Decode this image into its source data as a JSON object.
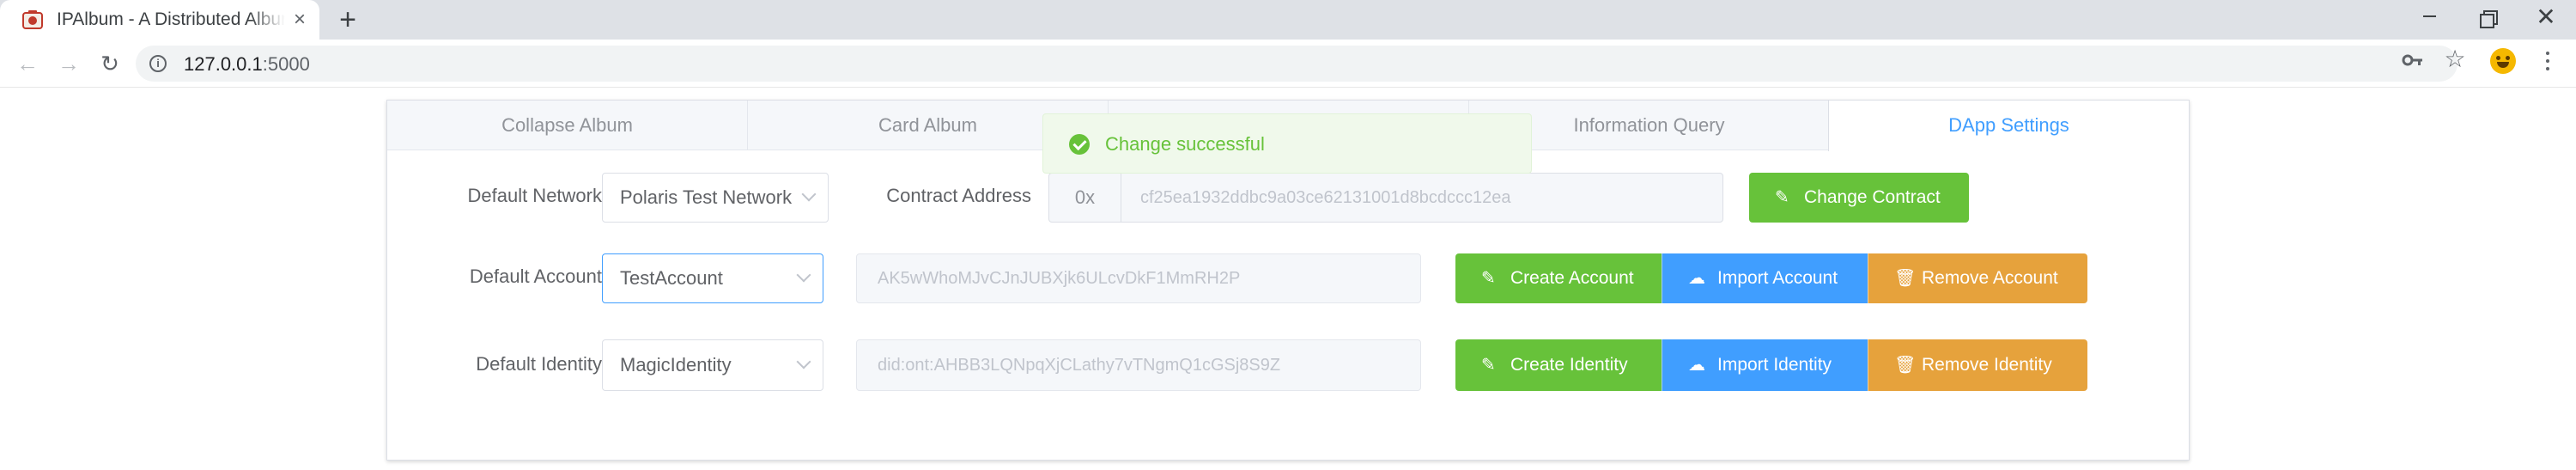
{
  "browser": {
    "tab_title": "IPAlbum - A Distributed Album",
    "tab_close": "×",
    "new_tab": "+",
    "url_host": "127.0.0.1",
    "url_port": ":5000",
    "window_close": "✕"
  },
  "app_tabs": [
    {
      "label": "Collapse Album"
    },
    {
      "label": "Card Album"
    },
    {
      "label": ""
    },
    {
      "label": "Information Query"
    },
    {
      "label": "DApp Settings",
      "active": true
    }
  ],
  "settings": {
    "network": {
      "label": "Default Network",
      "selected": "Polaris Test Network"
    },
    "contract": {
      "label": "Contract Address",
      "prefix": "0x",
      "value": "cf25ea1932ddbc9a03ce62131001d8bcdccc12ea",
      "button": "Change Contract"
    },
    "account": {
      "label": "Default Account",
      "selected": "TestAccount",
      "address": "AK5wWhoMJvCJnJUBXjk6ULcvDkF1MmRH2P",
      "create": "Create Account",
      "import": "Import Account",
      "remove": "Remove Account"
    },
    "identity": {
      "label": "Default Identity",
      "selected": "MagicIdentity",
      "did": "did:ont:AHBB3LQNpqXjCLathy7vTNgmQ1cGSj8S9Z",
      "create": "Create Identity",
      "import": "Import Identity",
      "remove": "Remove Identity"
    }
  },
  "toast": {
    "message": "Change successful",
    "type": "success"
  },
  "colors": {
    "primary": "#409eff",
    "success": "#67c23a",
    "warning": "#e6a23c"
  }
}
